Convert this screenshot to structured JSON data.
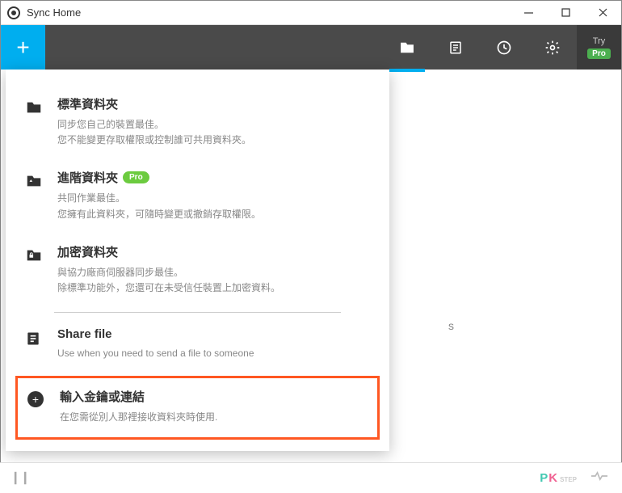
{
  "window": {
    "title": "Sync Home"
  },
  "toolbar": {
    "try_label": "Try",
    "pro_label": "Pro"
  },
  "dropdown": {
    "standard": {
      "title": "標準資料夾",
      "line1": "同步您自己的裝置最佳。",
      "line2": "您不能變更存取權限或控制誰可共用資料夾。"
    },
    "advanced": {
      "title": "進階資料夾",
      "badge": "Pro",
      "line1": "共同作業最佳。",
      "line2": "您擁有此資料夾，可隨時變更或撤銷存取權限。"
    },
    "encrypted": {
      "title": "加密資料夾",
      "line1": "與協力廠商伺服器同步最佳。",
      "line2": "除標準功能外，您還可在未受信任裝置上加密資料。"
    },
    "sharefile": {
      "title": "Share file",
      "desc": "Use when you need to send a file to someone"
    },
    "enterkey": {
      "title": "輸入金鑰或連結",
      "desc": "在您需從別人那裡接收資料夾時使用."
    }
  },
  "bg": {
    "s": "s"
  },
  "statusbar": {
    "pk_p": "P",
    "pk_k": "K",
    "pk_step": "STEP"
  }
}
